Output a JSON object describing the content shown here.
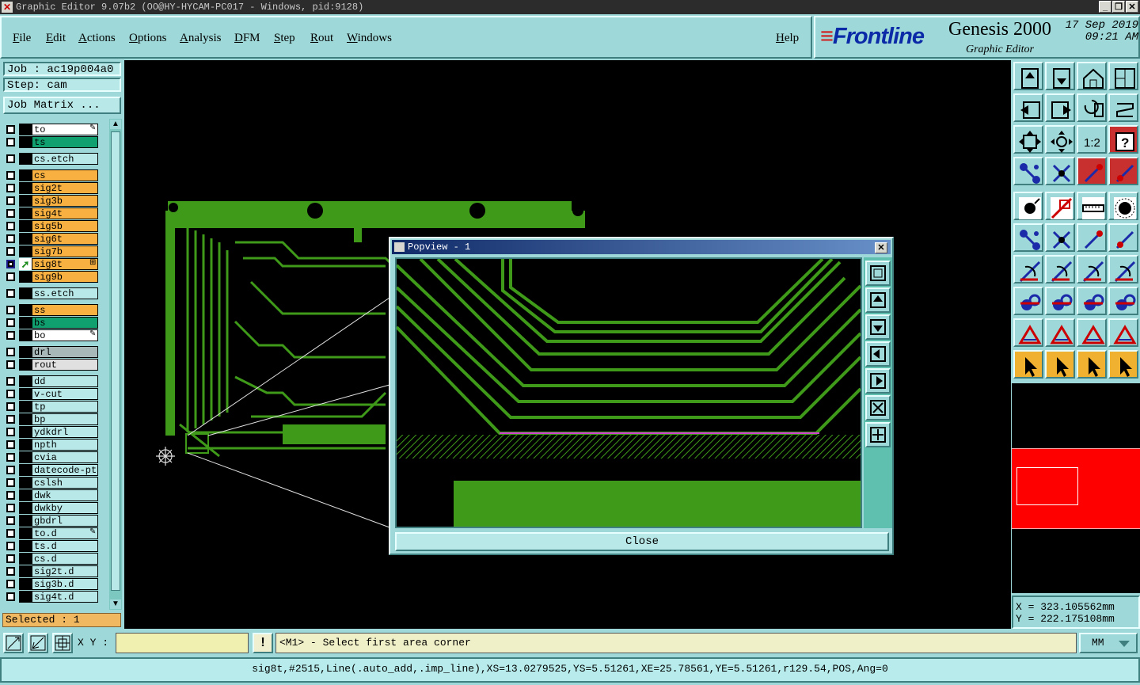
{
  "window": {
    "title": "Graphic Editor 9.07b2 (OO@HY-HYCAM-PC017 - Windows, pid:9128)",
    "btn_min": "_",
    "btn_max": "❐",
    "btn_close": "✕"
  },
  "menu": [
    "File",
    "Edit",
    "Actions",
    "Options",
    "Analysis",
    "DFM",
    "Step",
    "Rout",
    "Windows"
  ],
  "help": "Help",
  "brand": {
    "logo": "Frontline",
    "product": "Genesis 2000",
    "subtitle": "Graphic Editor",
    "date": "17 Sep 2019",
    "time": "09:21 AM"
  },
  "job": {
    "job_label": "Job : ac19p004a0",
    "step_label": "Step: cam",
    "matrix_button": "Job Matrix ..."
  },
  "layers": [
    {
      "name": "to",
      "color": "#ffffff",
      "mark": "✎"
    },
    {
      "name": "ts",
      "color": "#10a070"
    },
    {
      "name": "cs.etch",
      "color": "#b8e8e8",
      "gap": true
    },
    {
      "name": "cs",
      "color": "#f8b040",
      "gap": true
    },
    {
      "name": "sig2t",
      "color": "#f8b040"
    },
    {
      "name": "sig3b",
      "color": "#f8b040"
    },
    {
      "name": "sig4t",
      "color": "#f8b040"
    },
    {
      "name": "sig5b",
      "color": "#f8b040"
    },
    {
      "name": "sig6t",
      "color": "#f8b040"
    },
    {
      "name": "sig7b",
      "color": "#f8b040"
    },
    {
      "name": "sig8t",
      "color": "#f8b040",
      "selected": true,
      "mark": "⊞"
    },
    {
      "name": "sig9b",
      "color": "#f8b040"
    },
    {
      "name": "ss.etch",
      "color": "#b8e8e8",
      "gap": true
    },
    {
      "name": "ss",
      "color": "#f8b040",
      "gap": true
    },
    {
      "name": "bs",
      "color": "#10a070"
    },
    {
      "name": "bo",
      "color": "#ffffff",
      "mark": "✎"
    },
    {
      "name": "drl",
      "color": "#a8b8b8",
      "gap": true
    },
    {
      "name": "rout",
      "color": "#e0e0e0"
    },
    {
      "name": "dd",
      "color": "#b8e8e8",
      "gap": true
    },
    {
      "name": "v-cut",
      "color": "#b8e8e8"
    },
    {
      "name": "tp",
      "color": "#b8e8e8"
    },
    {
      "name": "bp",
      "color": "#b8e8e8"
    },
    {
      "name": "ydkdrl",
      "color": "#b8e8e8"
    },
    {
      "name": "npth",
      "color": "#b8e8e8"
    },
    {
      "name": "cvia",
      "color": "#b8e8e8"
    },
    {
      "name": "datecode-ptc",
      "color": "#b8e8e8"
    },
    {
      "name": "cslsh",
      "color": "#b8e8e8"
    },
    {
      "name": "dwk",
      "color": "#b8e8e8"
    },
    {
      "name": "dwkby",
      "color": "#b8e8e8"
    },
    {
      "name": "gbdrl",
      "color": "#b8e8e8"
    },
    {
      "name": "to.d",
      "color": "#b8e8e8",
      "mark": "✎"
    },
    {
      "name": "ts.d",
      "color": "#b8e8e8"
    },
    {
      "name": "cs.d",
      "color": "#b8e8e8"
    },
    {
      "name": "sig2t.d",
      "color": "#b8e8e8"
    },
    {
      "name": "sig3b.d",
      "color": "#b8e8e8"
    },
    {
      "name": "sig4t.d",
      "color": "#b8e8e8"
    }
  ],
  "selected_label": "Selected : 1",
  "popview": {
    "title": "Popview - 1",
    "close_label": "Close",
    "close_x": "✕"
  },
  "coords": {
    "x": "X  = 323.105562mm",
    "y": "Y  = 222.175108mm"
  },
  "command": {
    "xy_label": "X Y :",
    "xy_value": "",
    "bang": "!",
    "prompt": "<M1> - Select first area corner",
    "units": "MM"
  },
  "status": "sig8t,#2515,Line(.auto_add,.imp_line),XS=13.0279525,YS=5.51261,XE=25.78561,YE=5.51261,r129.54,POS,Ang=0",
  "toolbar_icons": [
    "zoom-home-icon",
    "zoom-down-icon",
    "home-icon",
    "window-icon",
    "pan-left-icon",
    "pan-right-icon",
    "undo-zoom-icon",
    "redraw-icon",
    "fit-icon",
    "fit-profile-icon",
    "scale-1-2-icon",
    "help-query-icon",
    "measure-tool-icon",
    "snap-icon",
    "layers-red-icon",
    "layers-red2-icon",
    "pad-icon",
    "line-icon",
    "ruler-icon",
    "dot-icon",
    "connect-icon",
    "cross-icon",
    "arrow-line-icon",
    "arrow-line2-icon",
    "angle-icon",
    "diag-line-icon",
    "arc-icon",
    "split-icon",
    "pad-red-icon",
    "minus-line-icon",
    "dim-icon",
    "multi-circle-icon",
    "triangle-icon",
    "triangle2-icon",
    "triangle3-icon",
    "triangle4-icon",
    "select-arrow-icon",
    "select-box-icon",
    "select-box2-icon",
    "select-net-icon"
  ],
  "colors": {
    "panel": "#9ed8d8",
    "copper": "#3f9a1a",
    "accent_orange": "#f8b040",
    "accent_teal": "#10a070"
  }
}
